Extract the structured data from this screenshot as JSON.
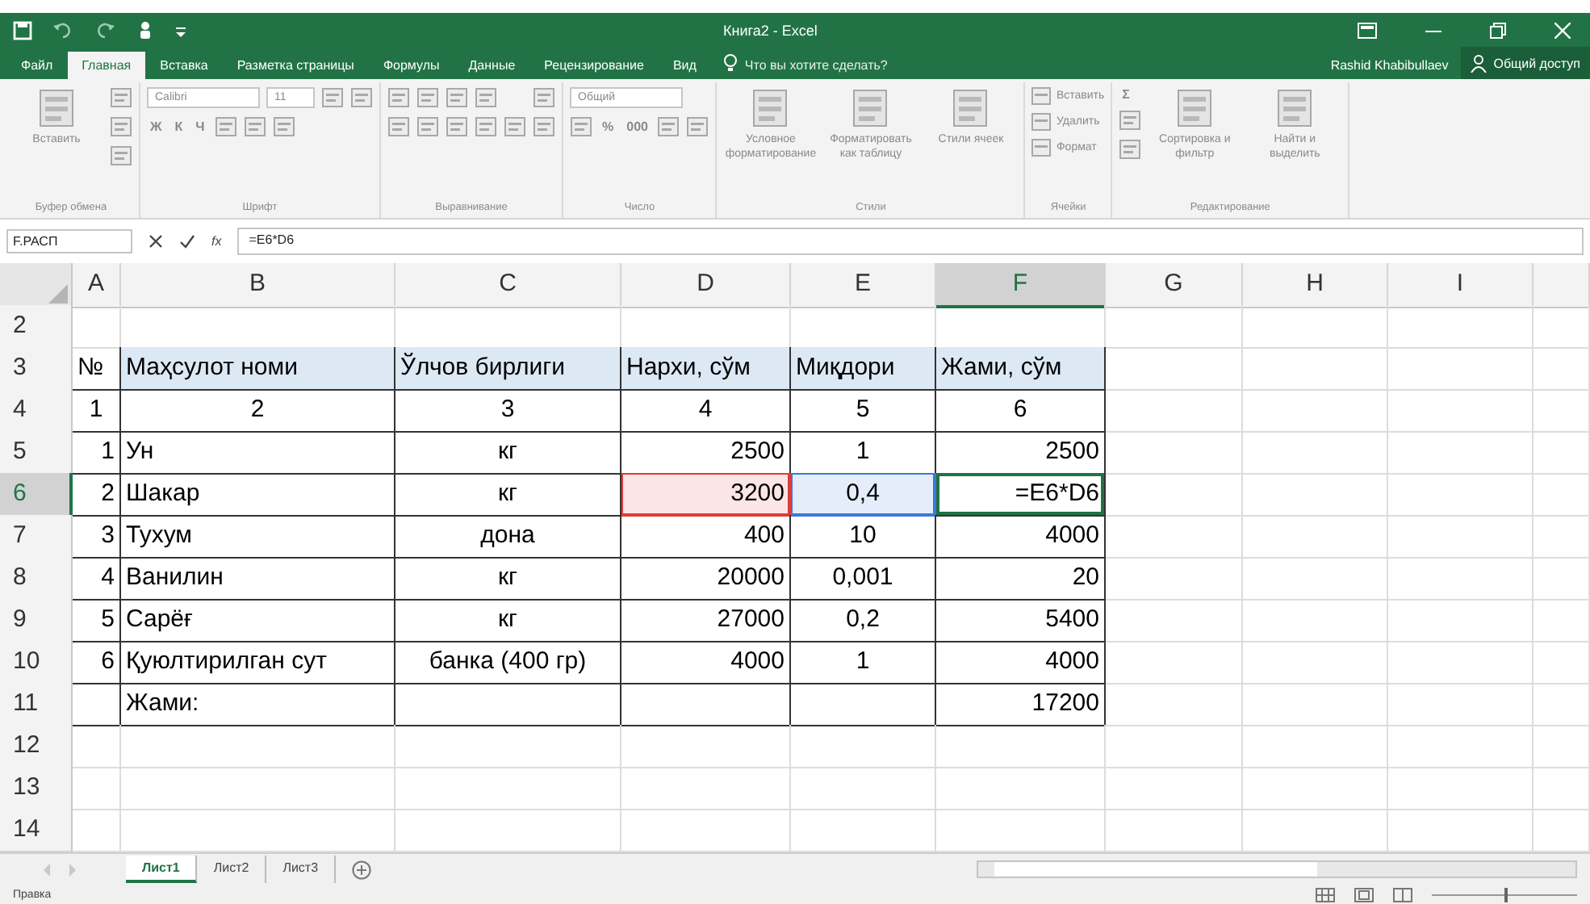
{
  "title_bar": {
    "title": "Книга2 - Excel",
    "user": "Rashid Khabibullaev",
    "share": "Общий доступ"
  },
  "menu_tabs": [
    {
      "label": "Файл",
      "selected": false
    },
    {
      "label": "Главная",
      "selected": true
    },
    {
      "label": "Вставка",
      "selected": false
    },
    {
      "label": "Разметка страницы",
      "selected": false
    },
    {
      "label": "Формулы",
      "selected": false
    },
    {
      "label": "Данные",
      "selected": false
    },
    {
      "label": "Рецензирование",
      "selected": false
    },
    {
      "label": "Вид",
      "selected": false
    }
  ],
  "tell_me": "Что вы хотите сделать?",
  "ribbon": {
    "disabled": true,
    "groups": [
      {
        "label": "Буфер обмена",
        "items": [
          {
            "kind": "large",
            "label": "Вставить"
          },
          {
            "kind": "column",
            "lines": [
              [
                {
                  "kind": "icon"
                }
              ],
              [
                {
                  "kind": "icon"
                }
              ],
              [
                {
                  "kind": "icon"
                }
              ]
            ]
          }
        ]
      },
      {
        "label": "Шрифт",
        "items": [
          {
            "kind": "column",
            "lines": [
              [
                {
                  "kind": "field",
                  "value": "Calibri"
                },
                {
                  "kind": "field",
                  "value": "11"
                },
                {
                  "kind": "icon"
                },
                {
                  "kind": "icon"
                }
              ],
              [
                {
                  "kind": "text",
                  "label": "Ж"
                },
                {
                  "kind": "text",
                  "label": "К"
                },
                {
                  "kind": "text",
                  "label": "Ч"
                },
                {
                  "kind": "icon"
                },
                {
                  "kind": "icon"
                },
                {
                  "kind": "icon"
                }
              ]
            ]
          }
        ]
      },
      {
        "label": "Выравнивание",
        "items": [
          {
            "kind": "column",
            "lines": [
              [
                {
                  "kind": "icon"
                },
                {
                  "kind": "icon"
                },
                {
                  "kind": "icon"
                },
                {
                  "kind": "icon"
                }
              ],
              [
                {
                  "kind": "icon"
                },
                {
                  "kind": "icon"
                },
                {
                  "kind": "icon"
                },
                {
                  "kind": "icon"
                },
                {
                  "kind": "icon"
                }
              ]
            ]
          },
          {
            "kind": "column",
            "lines": [
              [
                {
                  "kind": "icon"
                }
              ],
              [
                {
                  "kind": "icon"
                }
              ]
            ]
          }
        ]
      },
      {
        "label": "Число",
        "items": [
          {
            "kind": "column",
            "lines": [
              [
                {
                  "kind": "field",
                  "value": "Общий"
                }
              ],
              [
                {
                  "kind": "icon"
                },
                {
                  "kind": "text",
                  "label": "%"
                },
                {
                  "kind": "text",
                  "label": "000"
                },
                {
                  "kind": "icon"
                },
                {
                  "kind": "icon"
                }
              ]
            ]
          }
        ]
      },
      {
        "label": "Стили",
        "items": [
          {
            "kind": "large",
            "label": "Условное форматирование"
          },
          {
            "kind": "large",
            "label": "Форматировать как таблицу"
          },
          {
            "kind": "large",
            "label": "Стили ячеек"
          }
        ]
      },
      {
        "label": "Ячейки",
        "items": [
          {
            "kind": "column",
            "lines": [
              [
                {
                  "kind": "button",
                  "label": "Вставить"
                }
              ],
              [
                {
                  "kind": "button",
                  "label": "Удалить"
                }
              ],
              [
                {
                  "kind": "button",
                  "label": "Формат"
                }
              ]
            ]
          }
        ]
      },
      {
        "label": "Редактирование",
        "items": [
          {
            "kind": "column",
            "lines": [
              [
                {
                  "kind": "text",
                  "label": "Σ"
                }
              ],
              [
                {
                  "kind": "icon"
                }
              ],
              [
                {
                  "kind": "icon"
                }
              ]
            ]
          },
          {
            "kind": "large",
            "label": "Сортировка и фильтр"
          },
          {
            "kind": "large",
            "label": "Найти и выделить"
          }
        ]
      }
    ]
  },
  "formula_bar": {
    "name_box": "F.РАСП",
    "fx": "fx",
    "formula": "=E6*D6"
  },
  "grid": {
    "columns": [
      {
        "label": "A",
        "selected": false
      },
      {
        "label": "B",
        "selected": false
      },
      {
        "label": "C",
        "selected": false
      },
      {
        "label": "D",
        "selected": false
      },
      {
        "label": "E",
        "selected": false
      },
      {
        "label": "F",
        "selected": true
      },
      {
        "label": "G",
        "selected": false
      },
      {
        "label": "H",
        "selected": false
      },
      {
        "label": "I",
        "selected": false
      }
    ],
    "rows": [
      {
        "number": "2",
        "selected": false
      },
      {
        "number": "3",
        "kind": "header",
        "selected": false,
        "cells": [
          {
            "text": "№"
          },
          {
            "text": "Маҳсулот номи"
          },
          {
            "text": "Ўлчов бирлиги"
          },
          {
            "text": "Нархи, сўм"
          },
          {
            "text": "Миқдори"
          },
          {
            "text": "Жами, сўм"
          }
        ]
      },
      {
        "number": "4",
        "kind": "index",
        "selected": false,
        "cells": [
          {
            "text": "1"
          },
          {
            "text": "2"
          },
          {
            "text": "3"
          },
          {
            "text": "4"
          },
          {
            "text": "5"
          },
          {
            "text": "6"
          }
        ]
      },
      {
        "number": "5",
        "kind": "data",
        "selected": false,
        "cells": [
          {
            "text": "1"
          },
          {
            "text": "Ун"
          },
          {
            "text": "кг"
          },
          {
            "text": "2500"
          },
          {
            "text": "1"
          },
          {
            "text": "2500"
          }
        ]
      },
      {
        "number": "6",
        "kind": "data",
        "selected": true,
        "cells": [
          {
            "text": "2"
          },
          {
            "text": "Шакар"
          },
          {
            "text": "кг"
          },
          {
            "text": "3200",
            "color": "#e03b3b"
          },
          {
            "text": "0,4",
            "color": "#3c78d8"
          },
          {
            "text": "=E6*D6",
            "editing": true
          }
        ]
      },
      {
        "number": "7",
        "kind": "data",
        "selected": false,
        "cells": [
          {
            "text": "3"
          },
          {
            "text": "Тухум"
          },
          {
            "text": "дона"
          },
          {
            "text": "400"
          },
          {
            "text": "10"
          },
          {
            "text": "4000"
          }
        ]
      },
      {
        "number": "8",
        "kind": "data",
        "selected": false,
        "cells": [
          {
            "text": "4"
          },
          {
            "text": "Ванилин"
          },
          {
            "text": "кг"
          },
          {
            "text": "20000"
          },
          {
            "text": "0,001"
          },
          {
            "text": "20"
          }
        ]
      },
      {
        "number": "9",
        "kind": "data",
        "selected": false,
        "cells": [
          {
            "text": "5"
          },
          {
            "text": "Сарёғ"
          },
          {
            "text": "кг"
          },
          {
            "text": "27000"
          },
          {
            "text": "0,2"
          },
          {
            "text": "5400"
          }
        ]
      },
      {
        "number": "10",
        "kind": "data",
        "selected": false,
        "cells": [
          {
            "text": "6"
          },
          {
            "text": "Қуюлтирилган сут"
          },
          {
            "text": "банка (400 гр)"
          },
          {
            "text": "4000"
          },
          {
            "text": "1"
          },
          {
            "text": "4000"
          }
        ]
      },
      {
        "number": "11",
        "kind": "total",
        "selected": false,
        "cells": [
          {},
          {
            "text": "Жами:"
          },
          {},
          {},
          {},
          {
            "text": "17200"
          }
        ]
      },
      {
        "number": "12",
        "selected": false
      },
      {
        "number": "13",
        "selected": false
      },
      {
        "number": "14",
        "selected": false
      }
    ]
  },
  "sheet_tabs": [
    {
      "label": "Лист1",
      "selected": true
    },
    {
      "label": "Лист2",
      "selected": false
    },
    {
      "label": "Лист3",
      "selected": false
    }
  ],
  "status_bar": {
    "mode": "Правка",
    "zoom": {
      "level": 0.5
    }
  }
}
